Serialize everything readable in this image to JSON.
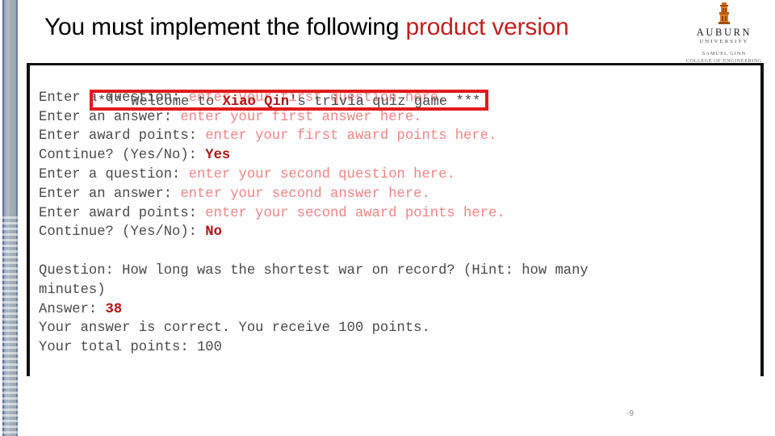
{
  "slide": {
    "title_plain": "You must implement the following ",
    "title_accent": "product version",
    "page_number": "-9",
    "accent_color": "#c21f1f",
    "input_color": "#f08585",
    "answer_color": "#b01616"
  },
  "logo": {
    "mark_icon": "auburn-tower-icon",
    "name": "AUBURN",
    "subtitle": "UNIVERSITY",
    "college_line1": "SAMUEL GINN",
    "college_line2": "COLLEGE OF ENGINEERING"
  },
  "terminal": {
    "welcome": {
      "prefix": "*** Welcome to ",
      "username": "Xiao Qin",
      "suffix": "'s trivia quiz game ***"
    },
    "lines": [
      {
        "kind": "io",
        "prompt": "Enter a question: ",
        "value": "enter your first question here."
      },
      {
        "kind": "io",
        "prompt": "Enter an answer: ",
        "value": "enter your first answer here."
      },
      {
        "kind": "io",
        "prompt": "Enter award points: ",
        "value": "enter your first award points here."
      },
      {
        "kind": "bold",
        "prompt": "Continue? (Yes/No): ",
        "value": "Yes"
      },
      {
        "kind": "io",
        "prompt": "Enter a question: ",
        "value": "enter your second question here."
      },
      {
        "kind": "io",
        "prompt": "Enter an answer: ",
        "value": "enter your second answer here."
      },
      {
        "kind": "io",
        "prompt": "Enter award points: ",
        "value": "enter your second award points here."
      },
      {
        "kind": "bold",
        "prompt": "Continue? (Yes/No): ",
        "value": "No"
      },
      {
        "kind": "blank",
        "prompt": "",
        "value": ""
      },
      {
        "kind": "plain",
        "prompt": "Question: How long was the shortest war on record? (Hint: how many",
        "value": ""
      },
      {
        "kind": "plain",
        "prompt": "minutes)",
        "value": ""
      },
      {
        "kind": "bold",
        "prompt": "Answer: ",
        "value": "38"
      },
      {
        "kind": "plain",
        "prompt": "Your answer is correct. You receive 100 points.",
        "value": ""
      },
      {
        "kind": "plain",
        "prompt": "Your total points: 100",
        "value": ""
      }
    ]
  }
}
